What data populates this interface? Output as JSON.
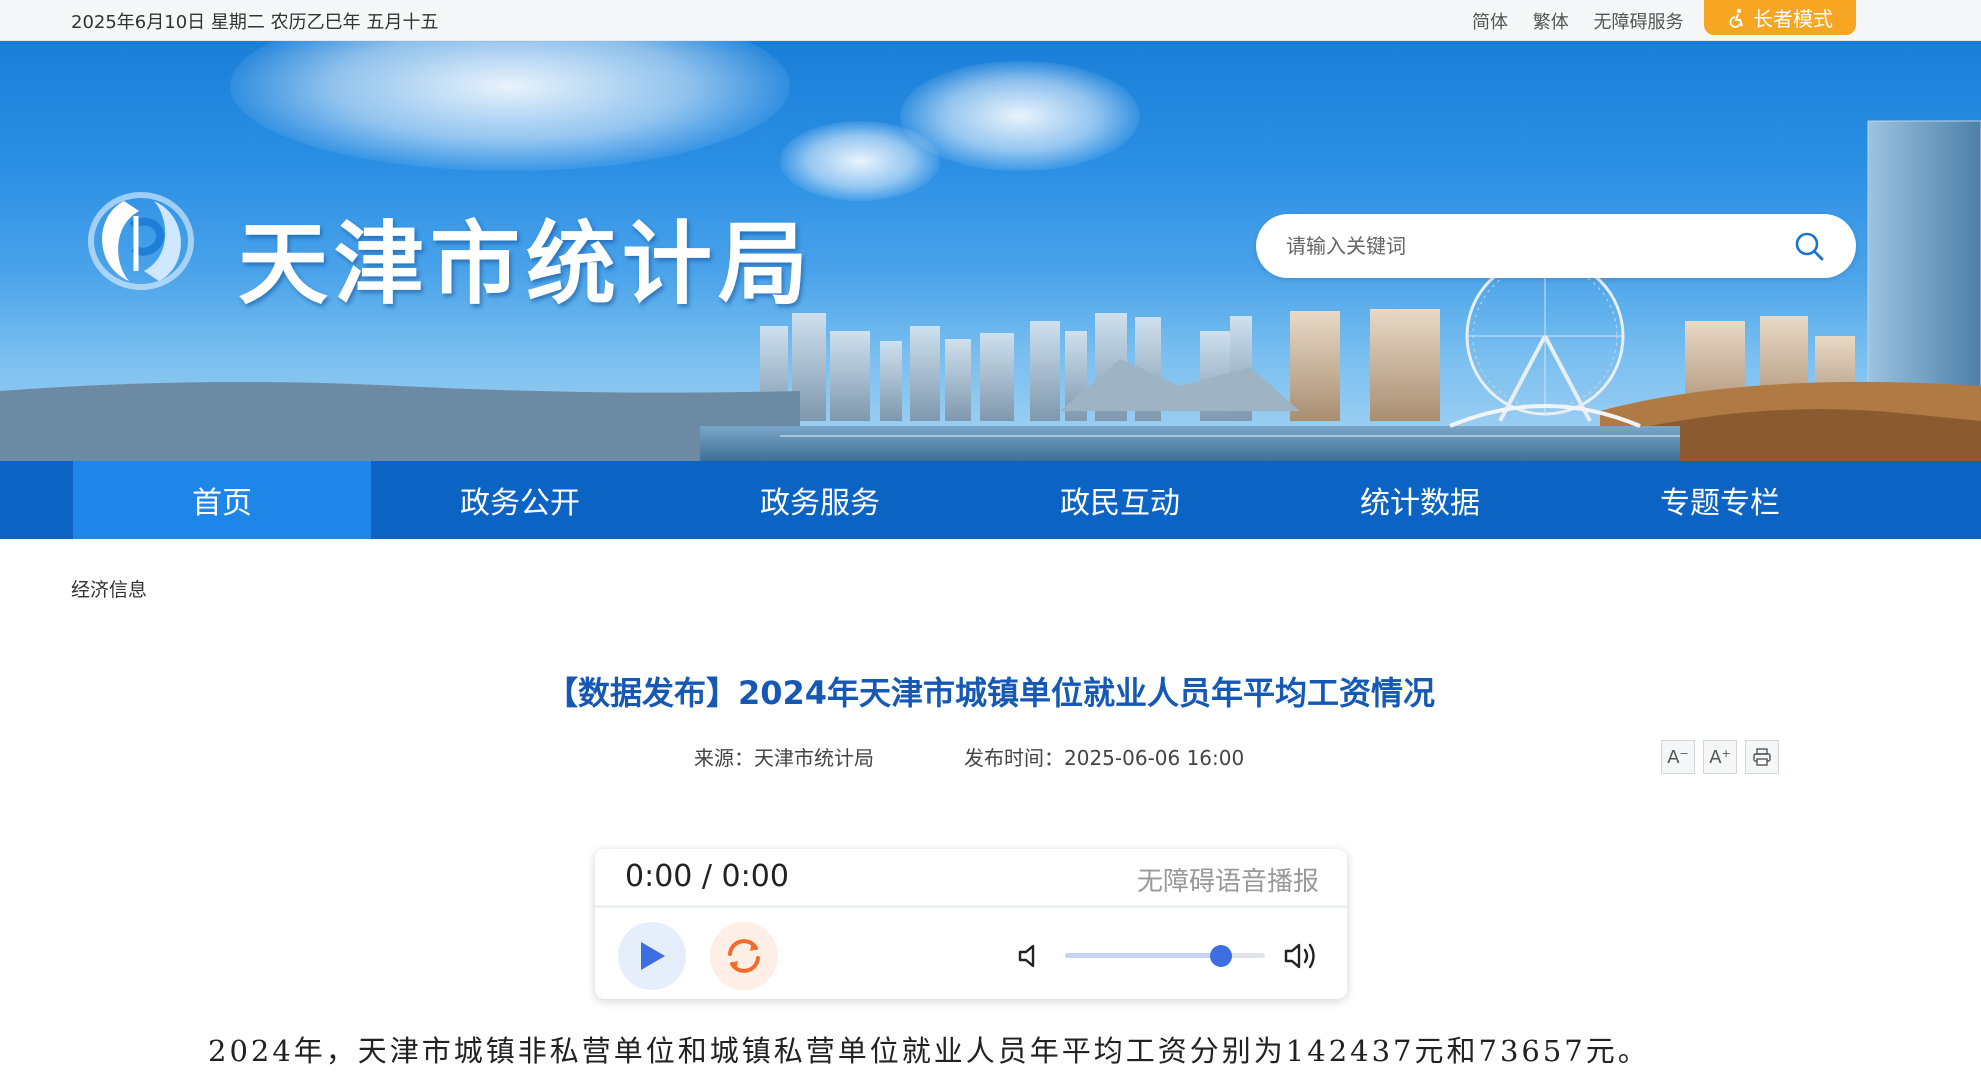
{
  "topbar": {
    "date": "2025年6月10日 星期二 农历乙巳年 五月十五",
    "links": [
      "简体",
      "繁体",
      "无障碍服务"
    ],
    "elder_mode": "长者模式"
  },
  "header": {
    "site_title": "天津市统计局",
    "search_placeholder": "请输入关键词"
  },
  "nav": {
    "items": [
      "首页",
      "政务公开",
      "政务服务",
      "政民互动",
      "统计数据",
      "专题专栏"
    ],
    "active": "首页"
  },
  "breadcrumb": "经济信息",
  "article": {
    "title": "【数据发布】2024年天津市城镇单位就业人员年平均工资情况",
    "source": "来源：天津市统计局",
    "published": "发布时间：2025-06-06 16:00",
    "font_decrease": "A",
    "font_increase": "A",
    "paragraph_1": "2024年，天津市城镇非私营单位和城镇私营单位就业人员年平均工资分别为142437元和73657元。"
  },
  "player": {
    "time": "0:00 / 0:00",
    "label": "无障碍语音播报",
    "volume_level": 0.78
  },
  "icons": [
    "accessibility-icon",
    "search-icon",
    "print-icon",
    "play-icon",
    "replay-icon",
    "volume-low-icon",
    "volume-high-icon",
    "logo-icon"
  ],
  "colors": {
    "nav_bg": "#0b63c4",
    "nav_active": "#1d86e8",
    "title_blue": "#1559b5",
    "elder_orange": "#f6a623",
    "knob_blue": "#3d6fe0"
  }
}
